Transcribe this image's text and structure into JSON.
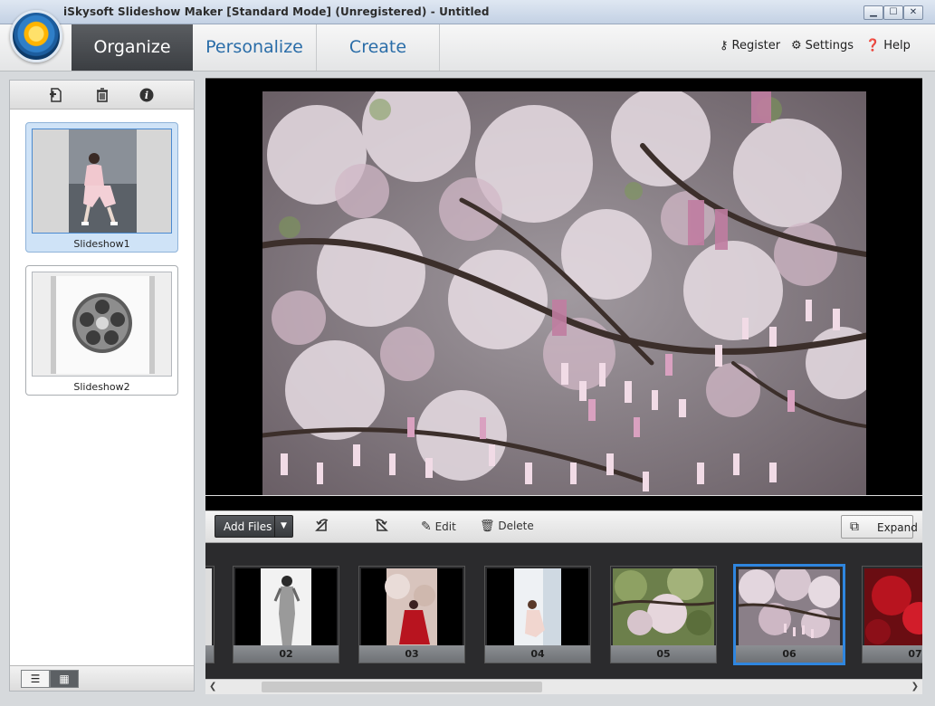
{
  "window": {
    "title": "iSkysoft Slideshow Maker [Standard Mode] (Unregistered) - Untitled",
    "minimize": "▁",
    "maximize": "☐",
    "close": "✕"
  },
  "nav": {
    "tabs": [
      {
        "label": "Organize"
      },
      {
        "label": "Personalize"
      },
      {
        "label": "Create"
      }
    ],
    "links": {
      "register": "Register",
      "settings": "Settings",
      "help": "Help"
    },
    "icons": {
      "register": "key-icon",
      "settings": "gear-icon",
      "help": "help-icon"
    }
  },
  "left_panel": {
    "tools": [
      "add-slideshow-icon",
      "trash-icon",
      "info-icon"
    ],
    "slideshows": [
      {
        "label": "Slideshow1",
        "selected": true
      },
      {
        "label": "Slideshow2",
        "selected": false
      }
    ],
    "view_modes": [
      "list-view-icon",
      "thumbnail-view-icon"
    ]
  },
  "files_toolbar": {
    "add_files": "Add Files",
    "edit": "Edit",
    "delete": "Delete",
    "expand": "Expand"
  },
  "filmstrip": {
    "items": [
      {
        "num": "02"
      },
      {
        "num": "03"
      },
      {
        "num": "04"
      },
      {
        "num": "05"
      },
      {
        "num": "06",
        "selected": true
      },
      {
        "num": "07"
      }
    ]
  },
  "colors": {
    "accent": "#2f86df",
    "tab_active": "#45484c",
    "tab_text": "#2a6da8"
  }
}
